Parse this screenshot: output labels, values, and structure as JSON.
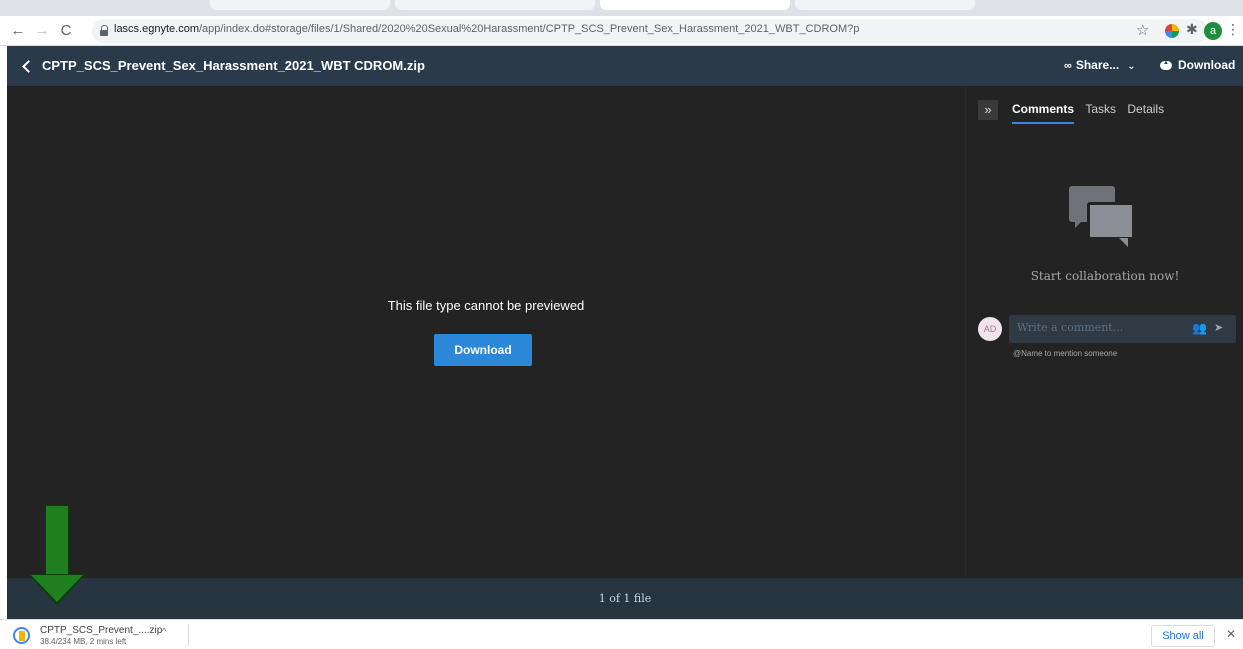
{
  "browser": {
    "url_host": "lascs.egnyte.com",
    "url_path": "/app/index.do#storage/files/1/Shared/2020%20Sexual%20Harassment/CPTP_SCS_Prevent_Sex_Harassment_2021_WBT_CDROM?p",
    "profile_initial": "a"
  },
  "header": {
    "file_title": "CPTP_SCS_Prevent_Sex_Harassment_2021_WBT CDROM.zip",
    "share_label": "Share...",
    "download_label": "Download"
  },
  "viewer": {
    "message": "This file type cannot be previewed",
    "download_button": "Download",
    "file_count": "1 of 1 file"
  },
  "panel": {
    "tabs": [
      {
        "label": "Comments",
        "active": true
      },
      {
        "label": "Tasks",
        "active": false
      },
      {
        "label": "Details",
        "active": false
      }
    ],
    "empty_message": "Start collaboration now!",
    "avatar_initials": "AD",
    "comment_placeholder": "Write a comment...",
    "mention_hint": "@Name to mention someone"
  },
  "download_shelf": {
    "file_name": "CPTP_SCS_Prevent_....zip",
    "status": "38.4/234 MB, 2 mins left",
    "show_all": "Show all"
  },
  "colors": {
    "header_bg": "#2a3a4a",
    "viewer_bg": "#232323",
    "accent": "#2b88d8",
    "annotation_arrow": "#1f7f1f"
  }
}
